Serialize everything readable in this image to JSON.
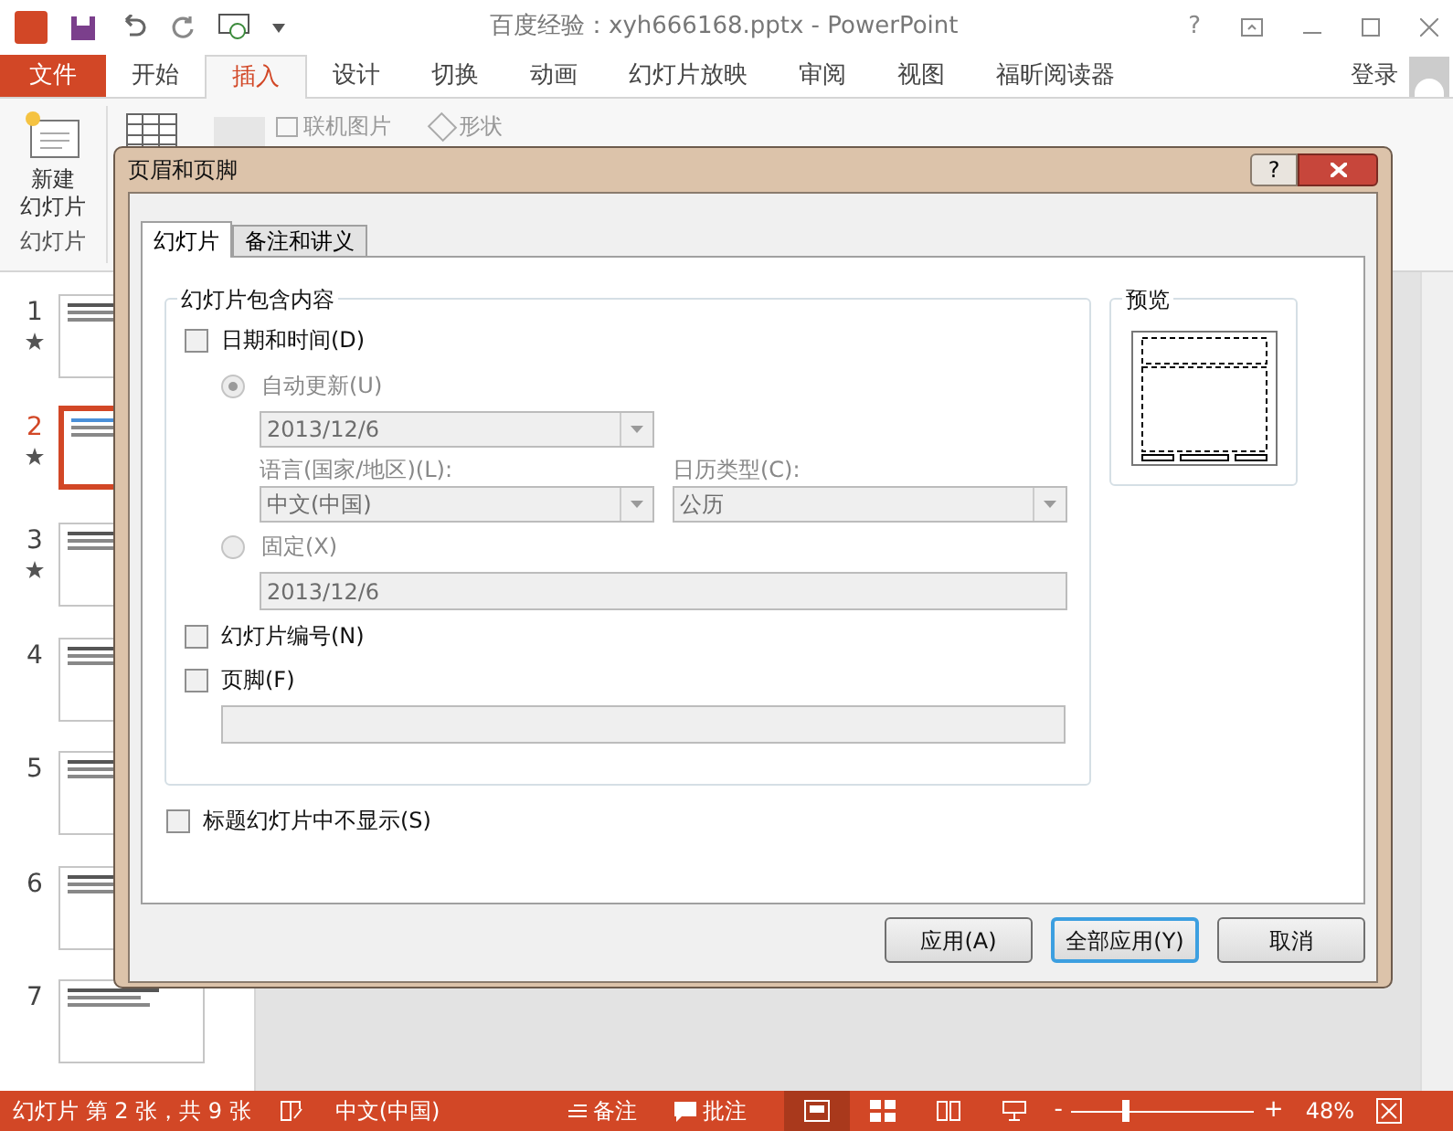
{
  "window": {
    "title": "百度经验：xyh666168.pptx - PowerPoint",
    "help": "?"
  },
  "ribbon_tabs": [
    {
      "label": "文件",
      "kind": "file",
      "selected": false
    },
    {
      "label": "开始",
      "kind": "tab",
      "selected": false
    },
    {
      "label": "插入",
      "kind": "tab",
      "selected": true
    },
    {
      "label": "设计",
      "kind": "tab",
      "selected": false
    },
    {
      "label": "切换",
      "kind": "tab",
      "selected": false
    },
    {
      "label": "动画",
      "kind": "tab",
      "selected": false
    },
    {
      "label": "幻灯片放映",
      "kind": "tab",
      "selected": false
    },
    {
      "label": "审阅",
      "kind": "tab",
      "selected": false
    },
    {
      "label": "视图",
      "kind": "tab",
      "selected": false
    },
    {
      "label": "福昕阅读器",
      "kind": "tab",
      "selected": false
    }
  ],
  "sign_in": "登录",
  "ribbon": {
    "new_slide": [
      "新建",
      "幻灯片"
    ],
    "group_label": "幻灯片",
    "online_pictures": "联机图片",
    "shapes": "形状"
  },
  "slides": [
    {
      "number": "1",
      "starred": true,
      "selected": false
    },
    {
      "number": "2",
      "starred": true,
      "selected": true
    },
    {
      "number": "3",
      "starred": true,
      "selected": false
    },
    {
      "number": "4",
      "starred": false,
      "selected": false
    },
    {
      "number": "5",
      "starred": false,
      "selected": false
    },
    {
      "number": "6",
      "starred": false,
      "selected": false
    },
    {
      "number": "7",
      "starred": false,
      "selected": false
    }
  ],
  "dialog": {
    "title": "页眉和页脚",
    "help": "?",
    "tabs": [
      {
        "label": "幻灯片",
        "selected": true
      },
      {
        "label": "备注和讲义",
        "selected": false
      }
    ],
    "group_title": "幻灯片包含内容",
    "date_time": {
      "label": "日期和时间(D)",
      "checked": false
    },
    "auto_update": {
      "label": "自动更新(U)",
      "selected": true
    },
    "auto_date": "2013/12/6",
    "language_label": "语言(国家/地区)(L):",
    "language": "中文(中国)",
    "calendar_label": "日历类型(C):",
    "calendar": "公历",
    "fixed": {
      "label": "固定(X)",
      "selected": false
    },
    "fixed_date": "2013/12/6",
    "slide_number": {
      "label": "幻灯片编号(N)",
      "checked": false
    },
    "footer": {
      "label": "页脚(F)",
      "checked": false
    },
    "hide_on_title": {
      "label": "标题幻灯片中不显示(S)",
      "checked": false
    },
    "preview_title": "预览",
    "buttons": [
      {
        "label": "应用(A)",
        "default": false
      },
      {
        "label": "全部应用(Y)",
        "default": true
      },
      {
        "label": "取消",
        "default": false
      }
    ]
  },
  "status_bar": {
    "slide_info": "幻灯片 第 2 张，共 9 张",
    "language": "中文(中国)",
    "notes": "备注",
    "comments": "批注",
    "views": [
      {
        "kind": "normal",
        "selected": true
      },
      {
        "kind": "sorter",
        "selected": false
      },
      {
        "kind": "reading",
        "selected": false
      },
      {
        "kind": "show",
        "selected": false
      }
    ],
    "zoom": {
      "level": 0.3,
      "reading": "48%",
      "minus": "-",
      "plus": "+"
    }
  }
}
